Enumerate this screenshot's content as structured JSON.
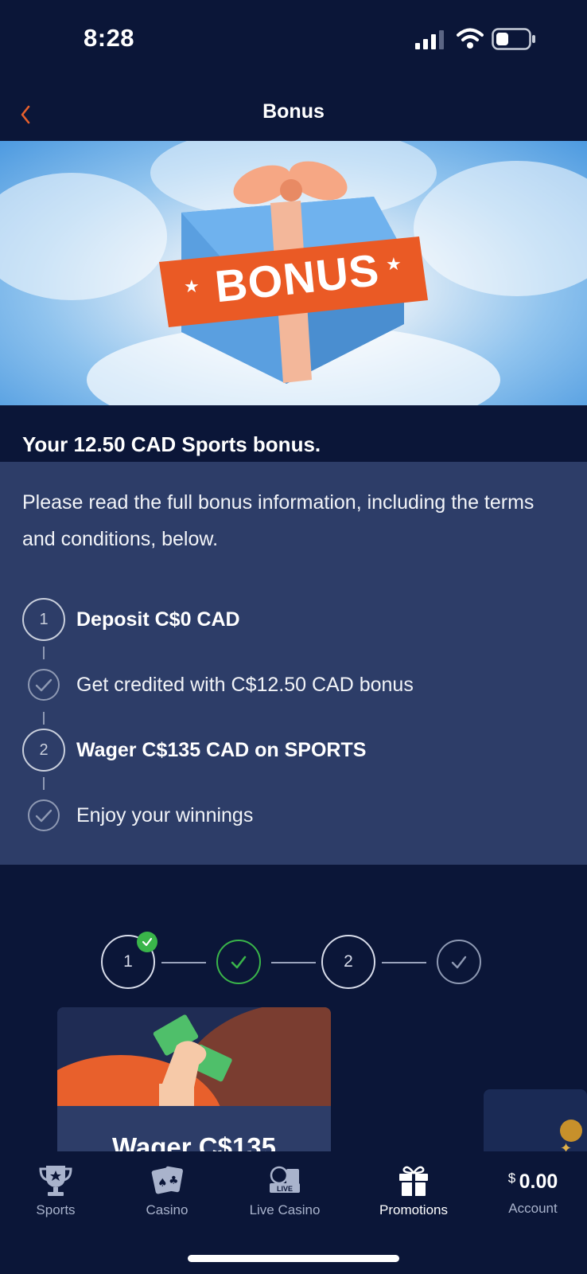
{
  "status_bar": {
    "time": "8:28"
  },
  "header": {
    "title": "Bonus"
  },
  "banner": {
    "badge_text": "BONUS"
  },
  "bonus": {
    "heading": "Your 12.50 CAD Sports bonus.",
    "info": "Please read the full bonus information, including the terms and conditions, below.",
    "steps": [
      {
        "marker": "1",
        "label": "Deposit C$0 CAD",
        "type": "number"
      },
      {
        "marker": "",
        "label": "Get credited with C$12.50 CAD bonus",
        "type": "check"
      },
      {
        "marker": "2",
        "label": "Wager C$135 CAD on SPORTS",
        "type": "number"
      },
      {
        "marker": "",
        "label": "Enjoy your winnings",
        "type": "check"
      }
    ]
  },
  "tracker": {
    "steps": [
      {
        "label": "1",
        "completed": true
      },
      {
        "label": "",
        "completed": true
      },
      {
        "label": "2",
        "completed": false
      },
      {
        "label": "",
        "completed": false
      }
    ]
  },
  "card": {
    "title": "Wager C$135"
  },
  "nav": {
    "items": [
      {
        "label": "Sports",
        "icon": "trophy-icon",
        "active": false
      },
      {
        "label": "Casino",
        "icon": "cards-icon",
        "active": false
      },
      {
        "label": "Live Casino",
        "icon": "live-casino-icon",
        "active": false
      },
      {
        "label": "Promotions",
        "icon": "gift-icon",
        "active": true
      },
      {
        "label": "Account",
        "icon": "balance",
        "active": false
      }
    ],
    "account_currency": "$",
    "account_balance": "0.00"
  },
  "colors": {
    "background": "#0b1638",
    "panel": "#2d3d68",
    "accent_orange": "#e8602c",
    "success_green": "#3ab54a"
  }
}
